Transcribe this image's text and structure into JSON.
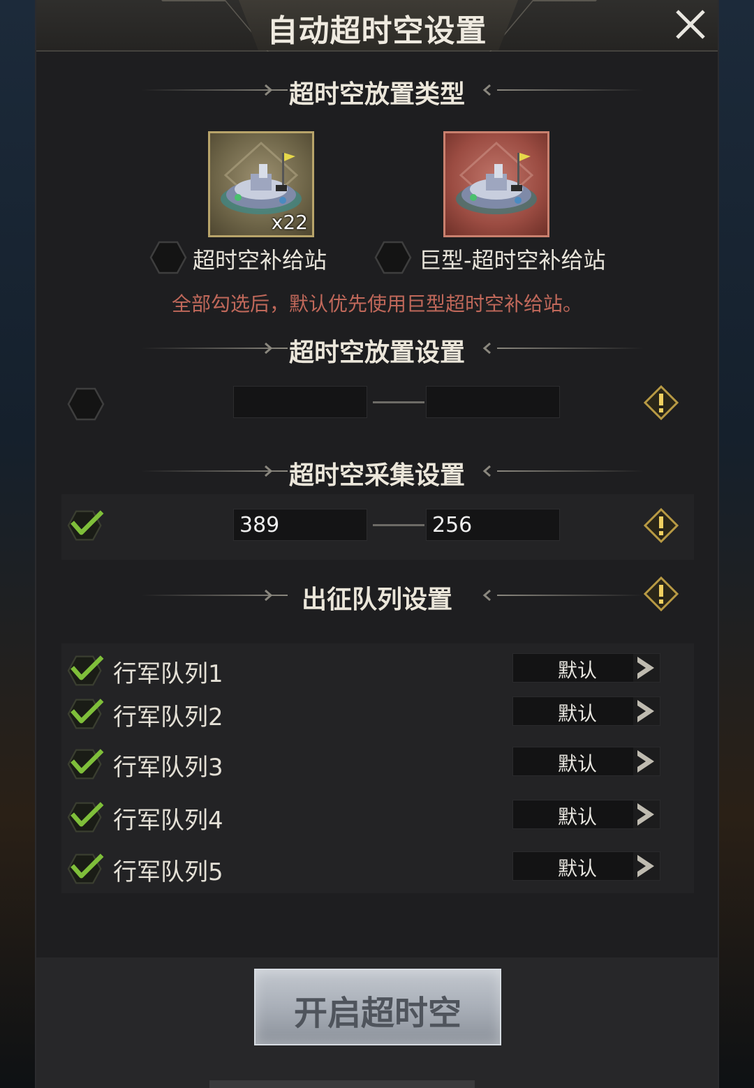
{
  "window": {
    "title": "自动超时空设置",
    "close_icon": "close-icon"
  },
  "sections": {
    "type": {
      "title": "超时空放置类型"
    },
    "placement": {
      "title": "超时空放置设置"
    },
    "gather": {
      "title": "超时空采集设置"
    },
    "queue": {
      "title": "出征队列设置"
    }
  },
  "placement_types": [
    {
      "label": "超时空补给站",
      "count": "x22",
      "checked": false
    },
    {
      "label": "巨型-超时空补给站",
      "checked": false
    }
  ],
  "notice": "全部勾选后，默认优先使用巨型超时空补给站。",
  "placement_setting": {
    "enabled": false,
    "min": "",
    "max": ""
  },
  "gather_setting": {
    "enabled": true,
    "min": "389",
    "max": "256"
  },
  "queues": [
    {
      "label": "行军队列1",
      "value": "默认",
      "checked": true
    },
    {
      "label": "行军队列2",
      "value": "默认",
      "checked": true
    },
    {
      "label": "行军队列3",
      "value": "默认",
      "checked": true
    },
    {
      "label": "行军队列4",
      "value": "默认",
      "checked": true
    },
    {
      "label": "行军队列5",
      "value": "默认",
      "checked": true
    }
  ],
  "start_button": {
    "label": "开启超时空"
  },
  "colors": {
    "accent_check": "#7fbf3a",
    "notice_text": "#c0685a",
    "warn_gold": "#d8b54a"
  }
}
